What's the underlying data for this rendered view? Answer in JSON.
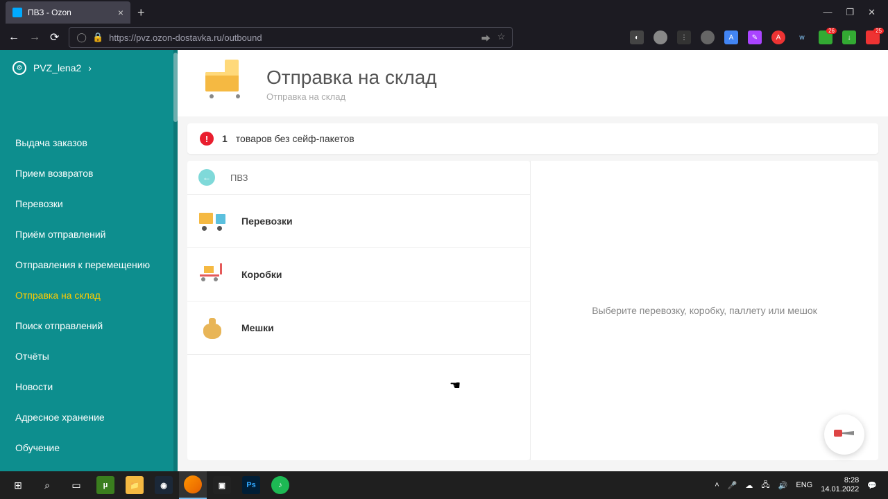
{
  "browser": {
    "tab_title": "ПВЗ - Ozon",
    "url": "https://pvz.ozon-dostavka.ru/outbound"
  },
  "sidebar": {
    "pvz_name": "PVZ_lena2",
    "items": [
      {
        "label": "Выдача заказов"
      },
      {
        "label": "Прием возвратов"
      },
      {
        "label": "Перевозки"
      },
      {
        "label": "Приём отправлений"
      },
      {
        "label": "Отправления к перемещению"
      },
      {
        "label": "Отправка на склад"
      },
      {
        "label": "Поиск отправлений"
      },
      {
        "label": "Отчёты"
      },
      {
        "label": "Новости"
      },
      {
        "label": "Адресное хранение"
      },
      {
        "label": "Обучение"
      }
    ]
  },
  "header": {
    "title": "Отправка на склад",
    "subtitle": "Отправка на склад"
  },
  "alert": {
    "count": "1",
    "text": "товаров без сейф-пакетов"
  },
  "list": {
    "pvz_label": "ПВЗ",
    "transports": "Перевозки",
    "boxes": "Коробки",
    "bags": "Мешки"
  },
  "detail": {
    "placeholder": "Выберите перевозку, коробку, паллету или мешок"
  },
  "taskbar": {
    "lang": "ENG",
    "time": "8:28",
    "date": "14.01.2022"
  }
}
